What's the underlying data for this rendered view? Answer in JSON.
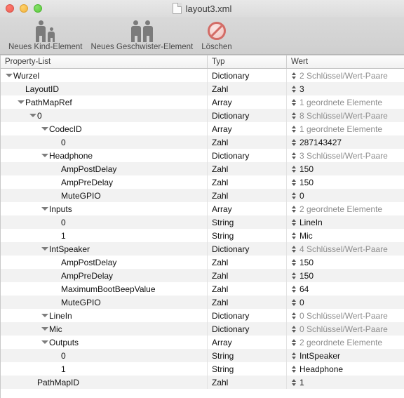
{
  "window": {
    "title": "layout3.xml",
    "doc_icon": "document-icon",
    "traffic_lights": [
      "close-button",
      "minimize-button",
      "zoom-button"
    ]
  },
  "toolbar": {
    "items": [
      {
        "label": "Neues Kind-Element",
        "icon": "adult-and-child-icon"
      },
      {
        "label": "Neues Geschwister-Element",
        "icon": "two-adults-icon"
      },
      {
        "label": "Löschen",
        "icon": "delete-prohibited-icon"
      }
    ]
  },
  "table": {
    "columns": [
      "Property-List",
      "Typ",
      "Wert"
    ],
    "rows": [
      {
        "key": "Wurzel",
        "indent": 0,
        "twisty": true,
        "typ": "Dictionary",
        "wert": "2 Schlüssel/Wert-Paare",
        "muted": true
      },
      {
        "key": "LayoutID",
        "indent": 1,
        "twisty": false,
        "typ": "Zahl",
        "wert": "3",
        "muted": false
      },
      {
        "key": "PathMapRef",
        "indent": 1,
        "twisty": true,
        "typ": "Array",
        "wert": "1 geordnete Elemente",
        "muted": true
      },
      {
        "key": "0",
        "indent": 2,
        "twisty": true,
        "typ": "Dictionary",
        "wert": "8 Schlüssel/Wert-Paare",
        "muted": true
      },
      {
        "key": "CodecID",
        "indent": 3,
        "twisty": true,
        "typ": "Array",
        "wert": "1 geordnete Elemente",
        "muted": true
      },
      {
        "key": "0",
        "indent": 4,
        "twisty": false,
        "typ": "Zahl",
        "wert": "287143427",
        "muted": false
      },
      {
        "key": "Headphone",
        "indent": 3,
        "twisty": true,
        "typ": "Dictionary",
        "wert": "3 Schlüssel/Wert-Paare",
        "muted": true
      },
      {
        "key": "AmpPostDelay",
        "indent": 4,
        "twisty": false,
        "typ": "Zahl",
        "wert": "150",
        "muted": false
      },
      {
        "key": "AmpPreDelay",
        "indent": 4,
        "twisty": false,
        "typ": "Zahl",
        "wert": "150",
        "muted": false
      },
      {
        "key": "MuteGPIO",
        "indent": 4,
        "twisty": false,
        "typ": "Zahl",
        "wert": "0",
        "muted": false
      },
      {
        "key": "Inputs",
        "indent": 3,
        "twisty": true,
        "typ": "Array",
        "wert": "2 geordnete Elemente",
        "muted": true
      },
      {
        "key": "0",
        "indent": 4,
        "twisty": false,
        "typ": "String",
        "wert": "LineIn",
        "muted": false
      },
      {
        "key": "1",
        "indent": 4,
        "twisty": false,
        "typ": "String",
        "wert": "Mic",
        "muted": false
      },
      {
        "key": "IntSpeaker",
        "indent": 3,
        "twisty": true,
        "typ": "Dictionary",
        "wert": "4 Schlüssel/Wert-Paare",
        "muted": true
      },
      {
        "key": "AmpPostDelay",
        "indent": 4,
        "twisty": false,
        "typ": "Zahl",
        "wert": "150",
        "muted": false
      },
      {
        "key": "AmpPreDelay",
        "indent": 4,
        "twisty": false,
        "typ": "Zahl",
        "wert": "150",
        "muted": false
      },
      {
        "key": "MaximumBootBeepValue",
        "indent": 4,
        "twisty": false,
        "typ": "Zahl",
        "wert": "64",
        "muted": false
      },
      {
        "key": "MuteGPIO",
        "indent": 4,
        "twisty": false,
        "typ": "Zahl",
        "wert": "0",
        "muted": false
      },
      {
        "key": "LineIn",
        "indent": 3,
        "twisty": true,
        "typ": "Dictionary",
        "wert": "0 Schlüssel/Wert-Paare",
        "muted": true
      },
      {
        "key": "Mic",
        "indent": 3,
        "twisty": true,
        "typ": "Dictionary",
        "wert": "0 Schlüssel/Wert-Paare",
        "muted": true
      },
      {
        "key": "Outputs",
        "indent": 3,
        "twisty": true,
        "typ": "Array",
        "wert": "2 geordnete Elemente",
        "muted": true
      },
      {
        "key": "0",
        "indent": 4,
        "twisty": false,
        "typ": "String",
        "wert": "IntSpeaker",
        "muted": false
      },
      {
        "key": "1",
        "indent": 4,
        "twisty": false,
        "typ": "String",
        "wert": "Headphone",
        "muted": false
      },
      {
        "key": "PathMapID",
        "indent": 2,
        "twisty": false,
        "typ": "Zahl",
        "wert": "1",
        "muted": false
      }
    ]
  }
}
